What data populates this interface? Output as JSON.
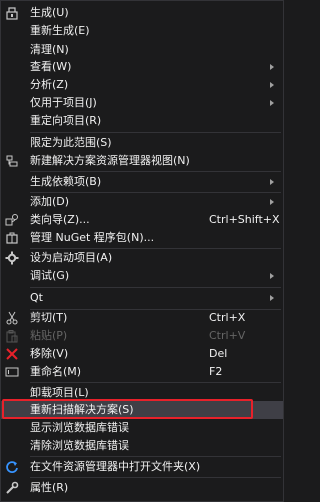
{
  "menu": {
    "build": "生成(U)",
    "rebuild": "重新生成(E)",
    "clean": "清理(N)",
    "view": "查看(W)",
    "analyze": "分析(Z)",
    "project_only": "仅用于项目(J)",
    "retarget": "重定向项目(R)",
    "scope_to_this": "限定为此范围(S)",
    "new_view": "新建解决方案资源管理器视图(N)",
    "build_dependencies": "生成依赖项(B)",
    "add": "添加(D)",
    "class_wizard": "类向导(Z)...",
    "class_wizard_shortcut": "Ctrl+Shift+X",
    "manage_nuget": "管理 NuGet 程序包(N)...",
    "set_startup": "设为启动项目(A)",
    "debug": "调试(G)",
    "qt": "Qt",
    "cut": "剪切(T)",
    "cut_shortcut": "Ctrl+X",
    "paste": "粘贴(P)",
    "paste_shortcut": "Ctrl+V",
    "remove": "移除(V)",
    "remove_shortcut": "Del",
    "rename": "重命名(M)",
    "rename_shortcut": "F2",
    "unload": "卸载项目(L)",
    "rescan": "重新扫描解决方案(S)",
    "show_db_errors": "显示浏览数据库错误",
    "clear_db_errors": "清除浏览数据库错误",
    "open_in_explorer": "在文件资源管理器中打开文件夹(X)",
    "properties": "属性(R)"
  },
  "colors": {
    "background": "#1b1b1c",
    "text": "#f1f1f1",
    "disabled_text": "#656565",
    "highlight_border": "#e8212a",
    "remove_icon": "#e8212a",
    "refresh_icon": "#3794ff"
  },
  "icons": [
    "build-icon",
    "new-view-icon",
    "class-wizard-icon",
    "nuget-icon",
    "gear-icon",
    "scissors-icon",
    "paste-icon",
    "remove-x-icon",
    "rename-icon",
    "refresh-icon",
    "wrench-icon"
  ]
}
